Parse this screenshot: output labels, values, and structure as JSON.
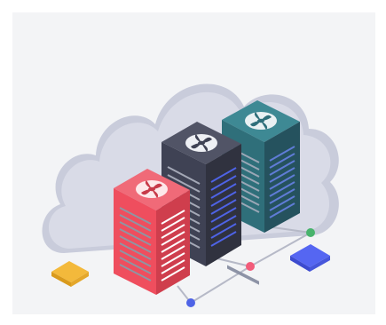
{
  "illustration": {
    "colors": {
      "background": "#f3f4f6",
      "cloud": "#d9dbe7",
      "cloud_shadow": "#c9ccdb",
      "server_red": "#ef4e5e",
      "server_dark": "#3f4254",
      "server_teal": "#2f6f7a",
      "server_vents": "#8d93a6",
      "connector_line": "#b6b9c7",
      "node_blue": "#4e63e6",
      "node_pink": "#f25c7a",
      "node_green": "#48b36c",
      "tile_yellow": "#f3b93b",
      "tile_blue": "#5566f2"
    },
    "icons": [
      "cloud-icon",
      "fan-icon",
      "server-rack-icon"
    ]
  }
}
